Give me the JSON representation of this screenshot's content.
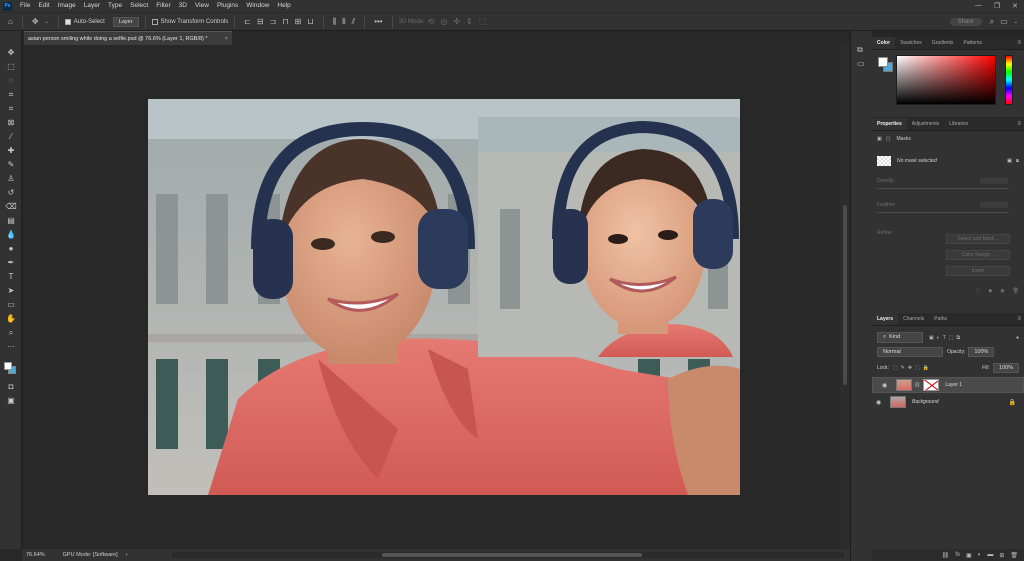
{
  "menu": {
    "items": [
      "File",
      "Edit",
      "Image",
      "Layer",
      "Type",
      "Select",
      "Filter",
      "3D",
      "View",
      "Plugins",
      "Window",
      "Help"
    ],
    "window_controls": [
      "—",
      "❐",
      "✕"
    ]
  },
  "options": {
    "auto_select_label": "Auto-Select",
    "auto_select_target": "Layer",
    "transform_label": "Show Transform Controls",
    "mode_3d_label": "3D Mode:",
    "share_label": "Share"
  },
  "document": {
    "tab_title": "asian person smiling while doing a selfie.psd @ 76.6% (Layer 1, RGB/8) *",
    "tab_close": "×"
  },
  "status": {
    "zoom": "76.64%",
    "gpu_mode": "GPU Mode: [Software]"
  },
  "panels": {
    "color_tabs": [
      "Color",
      "Swatches",
      "Gradients",
      "Patterns"
    ],
    "properties_tabs": [
      "Properties",
      "Adjustments",
      "Libraries"
    ],
    "masks_label": "Masks",
    "no_mask": "No mask selected",
    "density_label": "Density:",
    "feather_label": "Feather:",
    "refine_label": "Refine:",
    "select_mask_btn": "Select and Mask...",
    "color_range_btn": "Color Range...",
    "invert_btn": "Invert",
    "layers_tabs": [
      "Layers",
      "Channels",
      "Paths"
    ],
    "kind_label": "Kind",
    "blend_mode": "Normal",
    "opacity_label": "Opacity:",
    "opacity_value": "100%",
    "lock_label": "Lock:",
    "fill_label": "Fill:",
    "fill_value": "100%",
    "layers": [
      {
        "name": "Layer 1",
        "selected": true
      },
      {
        "name": "Background",
        "selected": false
      }
    ]
  },
  "colors": {
    "foreground": "#ffffff",
    "background": "#4fa8d8",
    "ps_blue": "#31a8ff"
  }
}
